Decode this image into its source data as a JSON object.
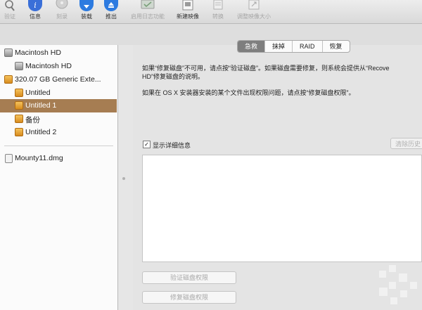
{
  "toolbar": {
    "items": [
      {
        "label": "验证",
        "icon": "verify-icon",
        "enabled": false
      },
      {
        "label": "信息",
        "icon": "info-icon",
        "enabled": true,
        "color": "#3a6fd8"
      },
      {
        "label": "刻录",
        "icon": "burn-icon",
        "enabled": false
      },
      {
        "label": "装载",
        "icon": "mount-icon",
        "enabled": true,
        "color": "#2d7be0"
      },
      {
        "label": "推出",
        "icon": "eject-icon",
        "enabled": true,
        "color": "#2d7be0"
      },
      {
        "label": "启用日志功能",
        "icon": "journal-icon",
        "enabled": false
      },
      {
        "label": "新建映像",
        "icon": "new-image-icon",
        "enabled": true
      },
      {
        "label": "转换",
        "icon": "convert-icon",
        "enabled": false
      },
      {
        "label": "调整映像大小",
        "icon": "resize-image-icon",
        "enabled": false
      }
    ]
  },
  "sidebar": {
    "items": [
      {
        "label": "Macintosh HD",
        "kind": "gray",
        "level": 0
      },
      {
        "label": "Macintosh HD",
        "kind": "gray",
        "level": 1
      },
      {
        "label": "320.07 GB Generic Exte...",
        "kind": "orange",
        "level": 0
      },
      {
        "label": "Untitled",
        "kind": "orange",
        "level": 1
      },
      {
        "label": "Untitled 1",
        "kind": "orange",
        "level": 1,
        "selected": true
      },
      {
        "label": "备份",
        "kind": "orange",
        "level": 1
      },
      {
        "label": "Untitled 2",
        "kind": "orange",
        "level": 1
      }
    ],
    "images": [
      {
        "label": "Mounty11.dmg",
        "kind": "dmg"
      }
    ]
  },
  "tabs": [
    {
      "label": "急救",
      "active": true
    },
    {
      "label": "抹掉",
      "active": false
    },
    {
      "label": "RAID",
      "active": false
    },
    {
      "label": "恢复",
      "active": false
    }
  ],
  "firstaid": {
    "para1_line1": "如果“修复磁盘”不可用，请点按“验证磁盘”。如果磁盘需要修复，则系统会提供从“Recove",
    "para1_line2": "HD”修复磁盘的说明。",
    "para2": "如果在 OS X 安装器安装的某个文件出现权限问题，请点按“修复磁盘权限”。",
    "show_details_label": "显示详细信息",
    "show_details_checked": true,
    "clear_history_label": "清除历史",
    "verify_permissions_label": "验证磁盘权限",
    "repair_permissions_label": "修复磁盘权限"
  }
}
